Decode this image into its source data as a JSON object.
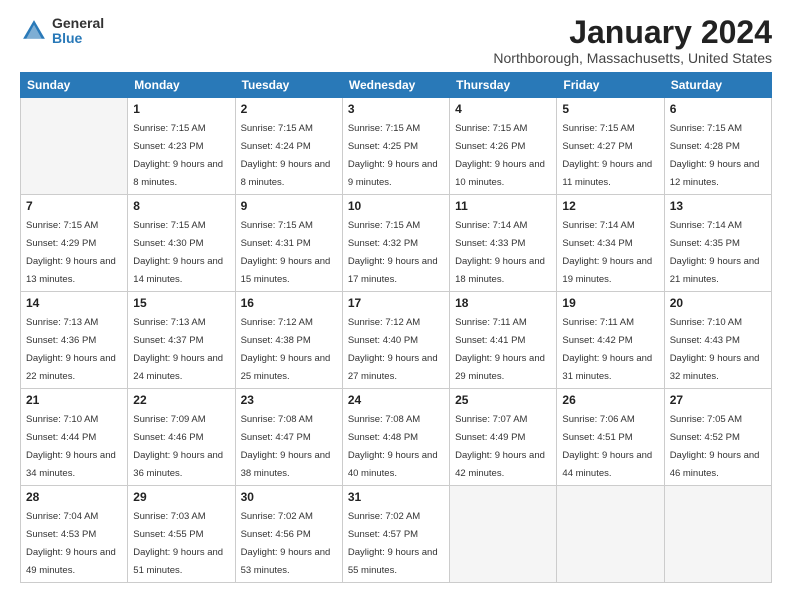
{
  "header": {
    "logo_general": "General",
    "logo_blue": "Blue",
    "title": "January 2024",
    "location": "Northborough, Massachusetts, United States"
  },
  "days_of_week": [
    "Sunday",
    "Monday",
    "Tuesday",
    "Wednesday",
    "Thursday",
    "Friday",
    "Saturday"
  ],
  "weeks": [
    [
      {
        "num": "",
        "empty": true
      },
      {
        "num": "1",
        "sunrise": "Sunrise: 7:15 AM",
        "sunset": "Sunset: 4:23 PM",
        "daylight": "Daylight: 9 hours and 8 minutes."
      },
      {
        "num": "2",
        "sunrise": "Sunrise: 7:15 AM",
        "sunset": "Sunset: 4:24 PM",
        "daylight": "Daylight: 9 hours and 8 minutes."
      },
      {
        "num": "3",
        "sunrise": "Sunrise: 7:15 AM",
        "sunset": "Sunset: 4:25 PM",
        "daylight": "Daylight: 9 hours and 9 minutes."
      },
      {
        "num": "4",
        "sunrise": "Sunrise: 7:15 AM",
        "sunset": "Sunset: 4:26 PM",
        "daylight": "Daylight: 9 hours and 10 minutes."
      },
      {
        "num": "5",
        "sunrise": "Sunrise: 7:15 AM",
        "sunset": "Sunset: 4:27 PM",
        "daylight": "Daylight: 9 hours and 11 minutes."
      },
      {
        "num": "6",
        "sunrise": "Sunrise: 7:15 AM",
        "sunset": "Sunset: 4:28 PM",
        "daylight": "Daylight: 9 hours and 12 minutes."
      }
    ],
    [
      {
        "num": "7",
        "sunrise": "Sunrise: 7:15 AM",
        "sunset": "Sunset: 4:29 PM",
        "daylight": "Daylight: 9 hours and 13 minutes."
      },
      {
        "num": "8",
        "sunrise": "Sunrise: 7:15 AM",
        "sunset": "Sunset: 4:30 PM",
        "daylight": "Daylight: 9 hours and 14 minutes."
      },
      {
        "num": "9",
        "sunrise": "Sunrise: 7:15 AM",
        "sunset": "Sunset: 4:31 PM",
        "daylight": "Daylight: 9 hours and 15 minutes."
      },
      {
        "num": "10",
        "sunrise": "Sunrise: 7:15 AM",
        "sunset": "Sunset: 4:32 PM",
        "daylight": "Daylight: 9 hours and 17 minutes."
      },
      {
        "num": "11",
        "sunrise": "Sunrise: 7:14 AM",
        "sunset": "Sunset: 4:33 PM",
        "daylight": "Daylight: 9 hours and 18 minutes."
      },
      {
        "num": "12",
        "sunrise": "Sunrise: 7:14 AM",
        "sunset": "Sunset: 4:34 PM",
        "daylight": "Daylight: 9 hours and 19 minutes."
      },
      {
        "num": "13",
        "sunrise": "Sunrise: 7:14 AM",
        "sunset": "Sunset: 4:35 PM",
        "daylight": "Daylight: 9 hours and 21 minutes."
      }
    ],
    [
      {
        "num": "14",
        "sunrise": "Sunrise: 7:13 AM",
        "sunset": "Sunset: 4:36 PM",
        "daylight": "Daylight: 9 hours and 22 minutes."
      },
      {
        "num": "15",
        "sunrise": "Sunrise: 7:13 AM",
        "sunset": "Sunset: 4:37 PM",
        "daylight": "Daylight: 9 hours and 24 minutes."
      },
      {
        "num": "16",
        "sunrise": "Sunrise: 7:12 AM",
        "sunset": "Sunset: 4:38 PM",
        "daylight": "Daylight: 9 hours and 25 minutes."
      },
      {
        "num": "17",
        "sunrise": "Sunrise: 7:12 AM",
        "sunset": "Sunset: 4:40 PM",
        "daylight": "Daylight: 9 hours and 27 minutes."
      },
      {
        "num": "18",
        "sunrise": "Sunrise: 7:11 AM",
        "sunset": "Sunset: 4:41 PM",
        "daylight": "Daylight: 9 hours and 29 minutes."
      },
      {
        "num": "19",
        "sunrise": "Sunrise: 7:11 AM",
        "sunset": "Sunset: 4:42 PM",
        "daylight": "Daylight: 9 hours and 31 minutes."
      },
      {
        "num": "20",
        "sunrise": "Sunrise: 7:10 AM",
        "sunset": "Sunset: 4:43 PM",
        "daylight": "Daylight: 9 hours and 32 minutes."
      }
    ],
    [
      {
        "num": "21",
        "sunrise": "Sunrise: 7:10 AM",
        "sunset": "Sunset: 4:44 PM",
        "daylight": "Daylight: 9 hours and 34 minutes."
      },
      {
        "num": "22",
        "sunrise": "Sunrise: 7:09 AM",
        "sunset": "Sunset: 4:46 PM",
        "daylight": "Daylight: 9 hours and 36 minutes."
      },
      {
        "num": "23",
        "sunrise": "Sunrise: 7:08 AM",
        "sunset": "Sunset: 4:47 PM",
        "daylight": "Daylight: 9 hours and 38 minutes."
      },
      {
        "num": "24",
        "sunrise": "Sunrise: 7:08 AM",
        "sunset": "Sunset: 4:48 PM",
        "daylight": "Daylight: 9 hours and 40 minutes."
      },
      {
        "num": "25",
        "sunrise": "Sunrise: 7:07 AM",
        "sunset": "Sunset: 4:49 PM",
        "daylight": "Daylight: 9 hours and 42 minutes."
      },
      {
        "num": "26",
        "sunrise": "Sunrise: 7:06 AM",
        "sunset": "Sunset: 4:51 PM",
        "daylight": "Daylight: 9 hours and 44 minutes."
      },
      {
        "num": "27",
        "sunrise": "Sunrise: 7:05 AM",
        "sunset": "Sunset: 4:52 PM",
        "daylight": "Daylight: 9 hours and 46 minutes."
      }
    ],
    [
      {
        "num": "28",
        "sunrise": "Sunrise: 7:04 AM",
        "sunset": "Sunset: 4:53 PM",
        "daylight": "Daylight: 9 hours and 49 minutes."
      },
      {
        "num": "29",
        "sunrise": "Sunrise: 7:03 AM",
        "sunset": "Sunset: 4:55 PM",
        "daylight": "Daylight: 9 hours and 51 minutes."
      },
      {
        "num": "30",
        "sunrise": "Sunrise: 7:02 AM",
        "sunset": "Sunset: 4:56 PM",
        "daylight": "Daylight: 9 hours and 53 minutes."
      },
      {
        "num": "31",
        "sunrise": "Sunrise: 7:02 AM",
        "sunset": "Sunset: 4:57 PM",
        "daylight": "Daylight: 9 hours and 55 minutes."
      },
      {
        "num": "",
        "empty": true
      },
      {
        "num": "",
        "empty": true
      },
      {
        "num": "",
        "empty": true
      }
    ]
  ]
}
